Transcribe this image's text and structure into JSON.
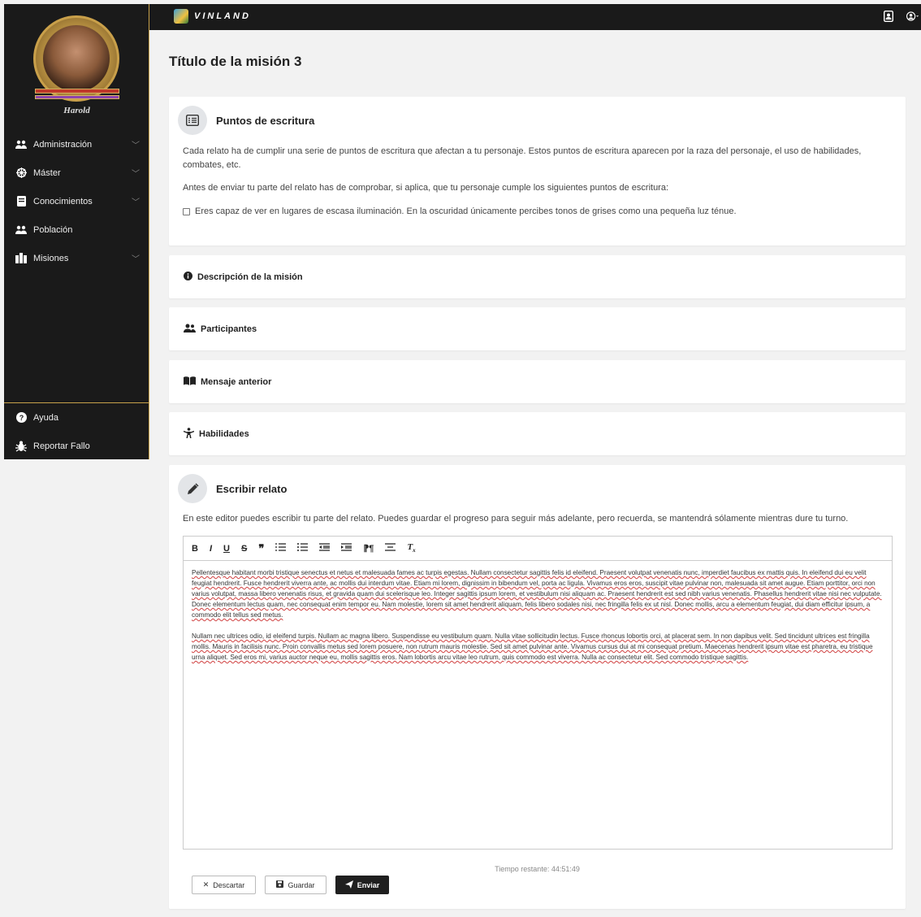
{
  "sidebar": {
    "character_name": "Harold",
    "items": [
      {
        "label": "Administración",
        "icon": "users-cog-icon",
        "has_chevron": true
      },
      {
        "label": "Máster",
        "icon": "dharma-wheel-icon",
        "has_chevron": true
      },
      {
        "label": "Conocimientos",
        "icon": "book-icon",
        "has_chevron": true
      },
      {
        "label": "Población",
        "icon": "users-icon",
        "has_chevron": false
      },
      {
        "label": "Misiones",
        "icon": "map-icon",
        "has_chevron": true
      }
    ],
    "bottom_items": [
      {
        "label": "Ayuda",
        "icon": "question-circle-icon"
      },
      {
        "label": "Reportar Fallo",
        "icon": "bug-icon"
      }
    ]
  },
  "topbar": {
    "logo_text": "VINLAND"
  },
  "page": {
    "title": "Título de la misión 3"
  },
  "writing_points": {
    "title": "Puntos de escritura",
    "intro": "Cada relato ha de cumplir una serie de puntos de escritura que afectan a tu personaje. Estos puntos de escritura aparecen por la raza del personaje, el uso de habilidades, combates, etc.",
    "instruction": "Antes de enviar tu parte del relato has de comprobar, si aplica, que tu personaje cumple los siguientes puntos de escritura:",
    "checklist": [
      "Eres capaz de ver en lugares de escasa iluminación. En la oscuridad únicamente percibes tonos de grises como una pequeña luz ténue."
    ]
  },
  "accordions": [
    {
      "label": "Descripción de la misión",
      "icon": "info-circle-icon"
    },
    {
      "label": "Participantes",
      "icon": "users-icon"
    },
    {
      "label": "Mensaje anterior",
      "icon": "book-open-icon"
    },
    {
      "label": "Habilidades",
      "icon": "person-icon"
    }
  ],
  "write": {
    "title": "Escribir relato",
    "intro": "En este editor puedes escribir tu parte del relato. Puedes guardar el progreso para seguir más adelante, pero recuerda, se mantendrá sólamente mientras dure tu turno.",
    "toolbar": [
      "B",
      "I",
      "U",
      "S",
      "99",
      "ordered-list",
      "bullet-list",
      "outdent",
      "indent",
      "rtl",
      "align",
      "clear-format"
    ],
    "paragraphs": [
      "Pellentesque habitant morbi tristique senectus et netus et malesuada fames ac turpis egestas. Nullam consectetur sagittis felis id eleifend. Praesent volutpat venenatis nunc, imperdiet faucibus ex mattis quis. In eleifend dui eu velit feugiat hendrerit. Fusce hendrerit viverra ante, ac mollis dui interdum vitae. Etiam mi lorem, dignissim in bibendum vel, porta ac ligula. Vivamus eros eros, suscipit vitae pulvinar non, malesuada sit amet augue. Etiam porttitor, orci non varius volutpat, massa libero venenatis risus, et gravida quam dui scelerisque leo. Integer sagittis ipsum lorem, et vestibulum nisi aliquam ac. Praesent hendrerit est sed nibh varius venenatis. Phasellus hendrerit vitae nisi nec vulputate. Donec elementum lectus quam, nec consequat enim tempor eu. Nam molestie, lorem sit amet hendrerit aliquam, felis libero sodales nisi, nec fringilla felis ex ut nisl. Donec mollis, arcu a elementum feugiat, dui diam efficitur ipsum, a commodo elit tellus sed metus.",
      "Nullam nec ultrices odio, id eleifend turpis. Nullam ac magna libero. Suspendisse eu vestibulum quam. Nulla vitae sollicitudin lectus. Fusce rhoncus lobortis orci, at placerat sem. In non dapibus velit. Sed tincidunt ultrices est fringilla mollis. Mauris in facilisis nunc. Proin convallis metus sed lorem posuere, non rutrum mauris molestie. Sed sit amet pulvinar ante. Vivamus cursus dui at mi consequat pretium. Maecenas hendrerit ipsum vitae est pharetra, eu tristique urna aliquet. Sed eros mi, varius auctor neque eu, mollis sagittis eros. Nam lobortis arcu vitae leo rutrum, quis commodo est viverra. Nulla ac consectetur elit. Sed commodo tristique sagittis."
    ],
    "timer": "Tiempo restante: 44:51:49",
    "buttons": {
      "discard": "Descartar",
      "save": "Guardar",
      "send": "Enviar"
    }
  }
}
